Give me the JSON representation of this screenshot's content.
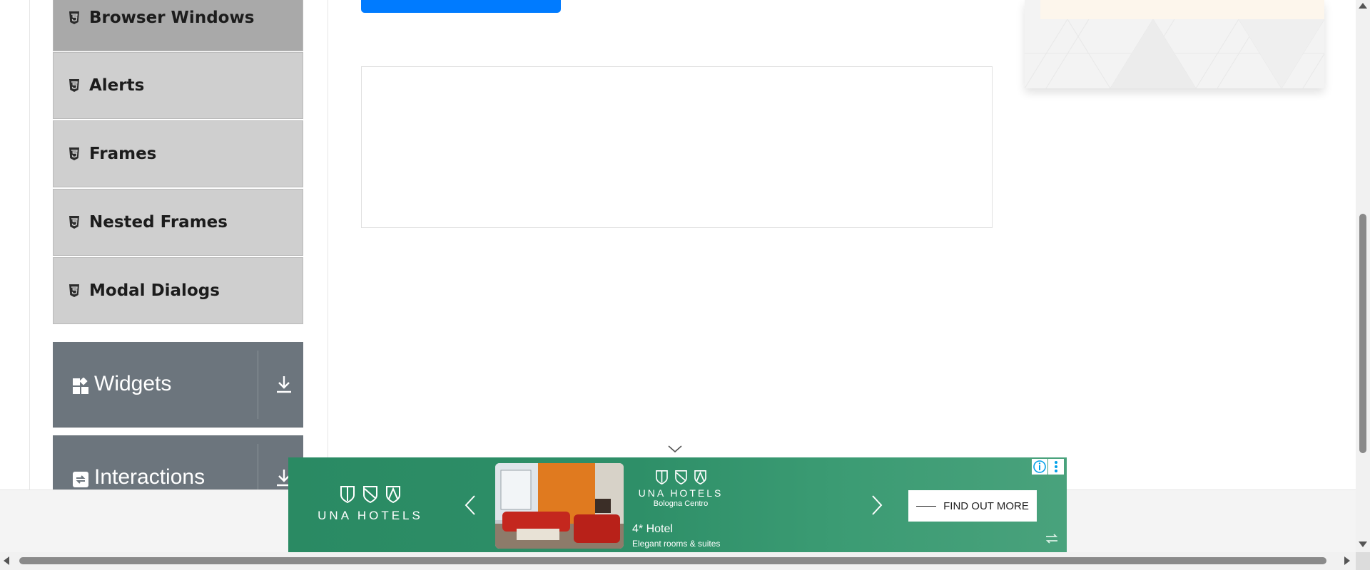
{
  "sidebar": {
    "items": [
      {
        "label": "Browser Windows",
        "icon": "html5-shield-icon",
        "active": true
      },
      {
        "label": "Alerts",
        "icon": "html5-shield-icon",
        "active": false
      },
      {
        "label": "Frames",
        "icon": "html5-shield-icon",
        "active": false
      },
      {
        "label": "Nested Frames",
        "icon": "html5-shield-icon",
        "active": false
      },
      {
        "label": "Modal Dialogs",
        "icon": "html5-shield-icon",
        "active": false
      }
    ],
    "groups": [
      {
        "label": "Widgets",
        "icon": "widgets-icon",
        "action_icon": "download-icon"
      },
      {
        "label": "Interactions",
        "icon": "interactions-icon",
        "action_icon": "download-icon"
      }
    ]
  },
  "ad": {
    "brand": "UNA HOTELS",
    "location": "Bologna Centro",
    "hotel_title": "4* Hotel",
    "hotel_subtitle": "Elegant rooms & suites",
    "cta_label": "FIND OUT MORE"
  },
  "colors": {
    "primary_button": "#007bff",
    "sidebar_item": "#cfcfcf",
    "sidebar_item_active": "#a9a9a9",
    "group_header": "#6c757d",
    "ad_green": "#2e8f68"
  }
}
